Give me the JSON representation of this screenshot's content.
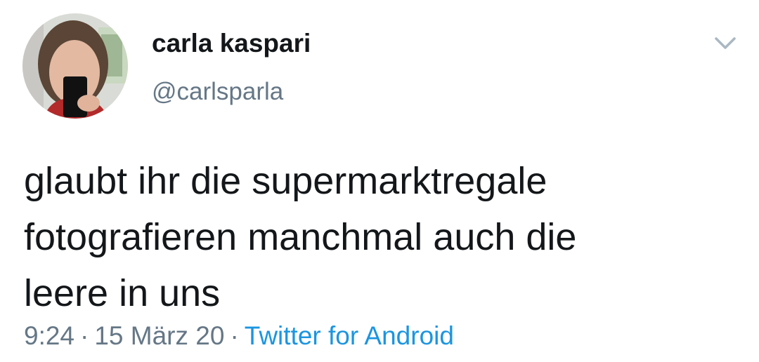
{
  "tweet": {
    "author": {
      "display_name": "carla kaspari",
      "handle": "@carlsparla",
      "avatar_icon": "profile-photo"
    },
    "menu_icon": "chevron-down-icon",
    "text_lines": [
      "glaubt ihr die supermarktregale",
      "fotografieren manchmal auch die",
      "leere in uns"
    ],
    "time": "9:24",
    "separator": "·",
    "date": "15 März 20",
    "source": "Twitter for Android",
    "colors": {
      "text": "#14171a",
      "secondary": "#657786",
      "link": "#1b95e0",
      "chevron": "#aab8c2"
    }
  }
}
